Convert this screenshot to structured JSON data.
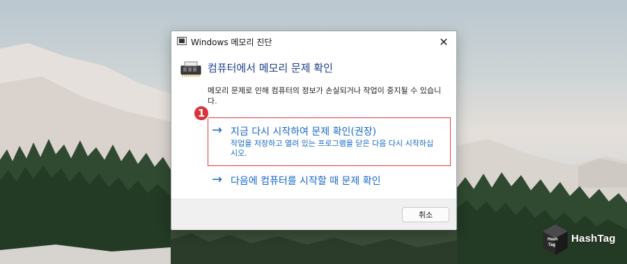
{
  "window": {
    "title": "Windows 메모리 진단",
    "close_glyph": "✕"
  },
  "dialog": {
    "header": "컴퓨터에서 메모리 문제 확인",
    "description": "메모리 문제로 인해 컴퓨터의 정보가 손실되거나 작업이 중지될 수 있습니다.",
    "options": [
      {
        "arrow": "→",
        "title": "지금 다시 시작하여 문제 확인(권장)",
        "subtitle": "작업을 저장하고 열려 있는 프로그램을 닫은 다음 다시 시작하십시오."
      },
      {
        "arrow": "→",
        "title": "다음에 컴퓨터를 시작할 때 문제 확인"
      }
    ],
    "cancel_label": "취소"
  },
  "annotation": {
    "step_number": "1",
    "highlight_color": "#e0393e"
  },
  "colors": {
    "link_blue": "#1667c7",
    "header_blue": "#1e3e8c"
  },
  "icons": {
    "app": "memory-chip-icon",
    "header": "memory-module-icon",
    "close": "close-icon"
  },
  "watermark": {
    "cube_text": "Hash Tag",
    "text": "HashTag"
  }
}
